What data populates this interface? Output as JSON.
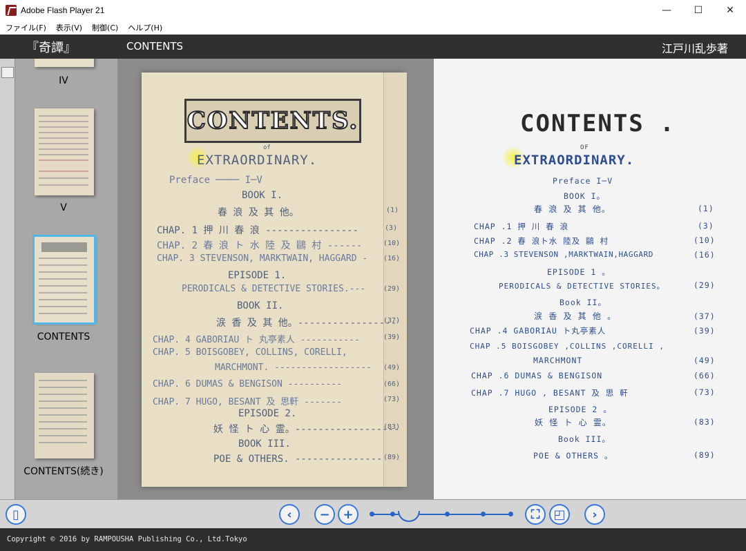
{
  "window": {
    "title": "Adobe Flash Player 21",
    "minimize": "—",
    "maximize": "☐",
    "close": "✕"
  },
  "menu": [
    "ファイル(F)",
    "表示(V)",
    "制御(C)",
    "ヘルプ(H)"
  ],
  "header": {
    "book_title": "『奇譚』",
    "section": "CONTENTS",
    "author": "江戸川乱歩著"
  },
  "sidebar": {
    "thumbnails": [
      {
        "label": "IV"
      },
      {
        "label": "V"
      },
      {
        "label": "CONTENTS",
        "selected": true
      },
      {
        "label": "CONTENTS(続き)"
      }
    ]
  },
  "left_page": {
    "heading": "CONTENTS.",
    "subtitle": "EXTRAORDINARY.",
    "of": "of",
    "lines": [
      {
        "text": "Preface ──── I─V"
      },
      {
        "text": "BOOK I."
      },
      {
        "text": "春 浪 及 其 他。",
        "page": "(1)"
      },
      {
        "text": "CHAP. 1   押 川 春 浪 ----------------",
        "page": "(3)"
      },
      {
        "text": "CHAP. 2   春 浪 ト 水 陸 及 鷗 村 ------",
        "page": "(10)"
      },
      {
        "text": "CHAP. 3   STEVENSON, MARKTWAIN, HAGGARD -",
        "page": "(16)"
      },
      {
        "text": "EPISODE 1."
      },
      {
        "text": "PERODICALS & DETECTIVE STORIES.---",
        "page": "(29)"
      },
      {
        "text": "BOOK II."
      },
      {
        "text": "涙 香 及 其 他。-----------------",
        "page": "(37)"
      },
      {
        "text": "CHAP. 4   GABORIAU ト 丸亭素人 -----------",
        "page": "(39)"
      },
      {
        "text": "CHAP. 5   BOISGOBEY, COLLINS, CORELLI,"
      },
      {
        "text": "MARCHMONT. ------------------",
        "page": "(49)"
      },
      {
        "text": "CHAP. 6   DUMAS & BENGISON ----------",
        "page": "(66)"
      },
      {
        "text": "CHAP. 7   HUGO, BESANT 及 思軒 -------",
        "page": "(73)"
      },
      {
        "text": "EPISODE 2."
      },
      {
        "text": "妖 怪 ト 心 霊。------------------",
        "page": "(83)"
      },
      {
        "text": "BOOK III."
      },
      {
        "text": "POE  &  OTHERS. ---------------",
        "page": "(89)"
      }
    ]
  },
  "right_page": {
    "heading": "CONTENTS .",
    "of": "OF",
    "subtitle": "EXTRAORDINARY.",
    "lines": [
      {
        "text": "Preface        I─V"
      },
      {
        "text": "BOOK  I。"
      },
      {
        "text": "春  浪  及  其  他。",
        "page": "(1)"
      },
      {
        "text": "CHAP .1     押 川 春 浪",
        "page": "(3)"
      },
      {
        "text": "CHAP .2   春 浪ト水 陸及 鷗 村",
        "page": "(10)"
      },
      {
        "text": "CHAP .3    STEVENSON ,MARKTWAIN,HAGGARD",
        "page": "(16)"
      },
      {
        "text": "EPISODE  1 。"
      },
      {
        "text": "PERODICALS & DETECTIVE STORIES。",
        "page": "(29)"
      },
      {
        "text": "Book  II。"
      },
      {
        "text": "涙 香 及 其 他  。",
        "page": "(37)"
      },
      {
        "text": "CHAP .4    GABORIAU  ト丸亭素人",
        "page": "(39)"
      },
      {
        "text": "CHAP .5    BOISGOBEY ,COLLINS ,CORELLI ,"
      },
      {
        "text": "MARCHMONT",
        "page": "(49)"
      },
      {
        "text": "CHAP .6    DUMAS  &  BENGISON",
        "page": "(66)"
      },
      {
        "text": "CHAP .7    HUGO , BESANT 及 思 軒",
        "page": "(73)"
      },
      {
        "text": "EPISODE  2 。"
      },
      {
        "text": "妖  怪 ト 心  霊。",
        "page": "(83)"
      },
      {
        "text": "Book  III。"
      },
      {
        "text": "POE   &   OTHERS  。",
        "page": "(89)"
      }
    ]
  },
  "footer": {
    "copyright": "Copyright © 2016 by RAMPOUSHA Publishing Co., Ltd.Tokyo"
  },
  "toolbar": {
    "sidebar_toggle": "▯",
    "prev": "‹",
    "zoom_out": "−",
    "zoom_in": "+",
    "fit": "⛶",
    "single_page": "◰",
    "next": "›"
  },
  "colors": {
    "header_bg": "#303030",
    "accent": "#2a64c8",
    "selection": "#4fb8e8"
  }
}
